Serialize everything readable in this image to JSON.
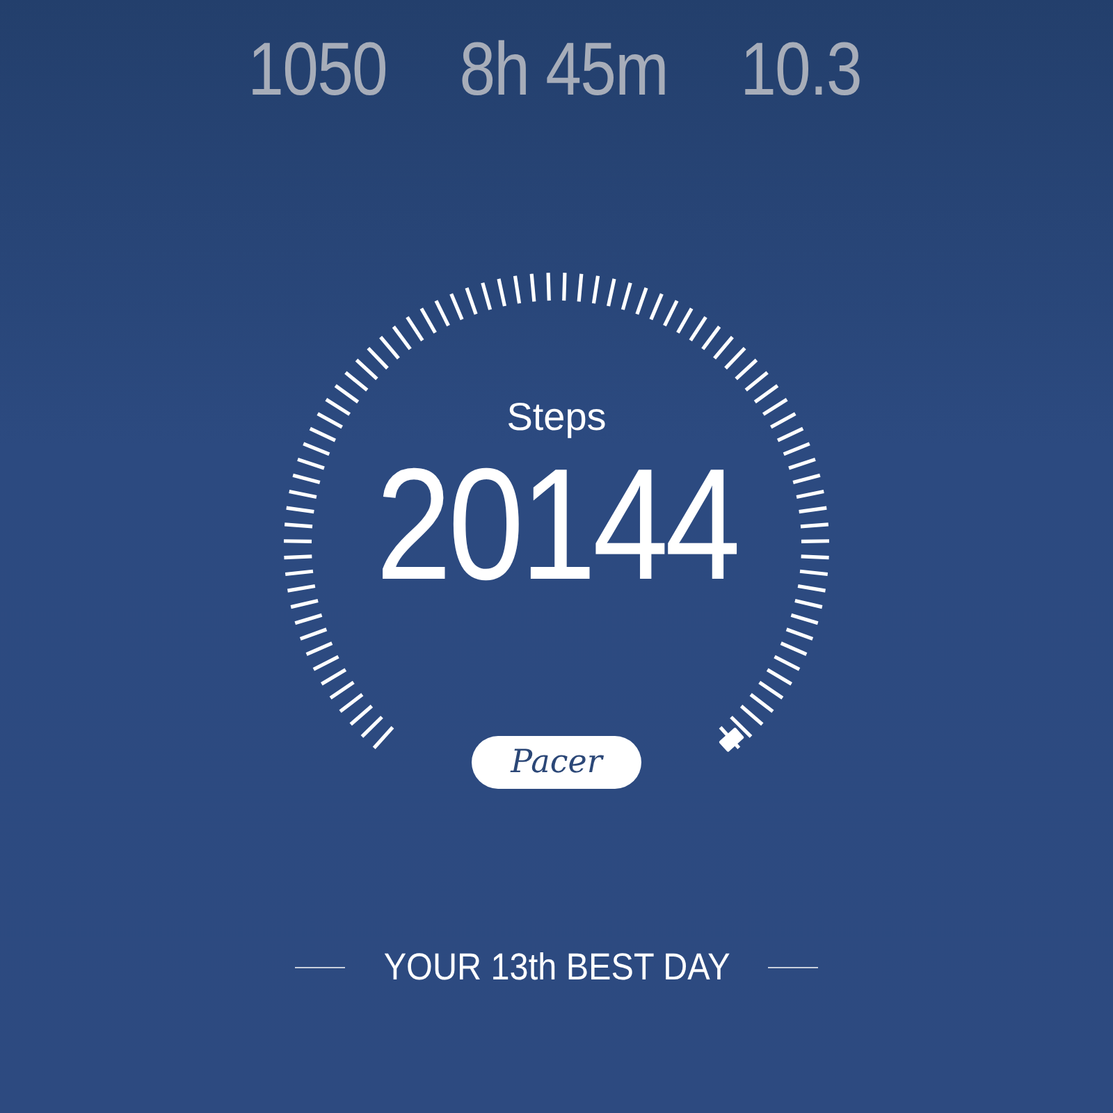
{
  "stats": [
    {
      "value": "1050"
    },
    {
      "value": "8h 45m"
    },
    {
      "value": "10.3"
    }
  ],
  "gauge": {
    "label": "Steps",
    "value": "20144"
  },
  "logo": "Pacer",
  "footer": "YOUR 13th BEST DAY"
}
